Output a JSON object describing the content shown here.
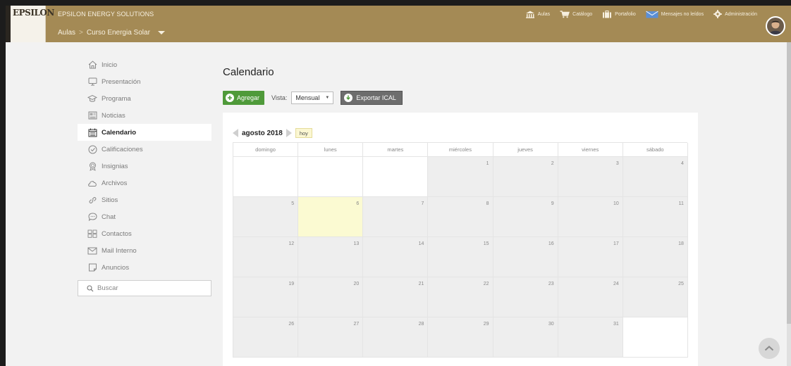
{
  "header": {
    "logo_text": "EPSILON",
    "org_name": "EPSILON ENERGY SOLUTIONS",
    "breadcrumb": {
      "root": "Aulas",
      "separator": ">",
      "current": "Curso Energia Solar"
    },
    "nav": [
      {
        "label": "Aulas",
        "icon": "building-icon"
      },
      {
        "label": "Catálogo",
        "icon": "cart-icon"
      },
      {
        "label": "Portafolio",
        "icon": "briefcase-icon"
      },
      {
        "label": "Mensajes no leídos",
        "icon": "envelope-icon"
      },
      {
        "label": "Administración",
        "icon": "gear-icon"
      }
    ]
  },
  "sidebar": {
    "items": [
      {
        "label": "Inicio",
        "icon": "home-icon",
        "active": false
      },
      {
        "label": "Presentación",
        "icon": "monitor-icon",
        "active": false
      },
      {
        "label": "Programa",
        "icon": "graduation-cap-icon",
        "active": false
      },
      {
        "label": "Noticias",
        "icon": "newspaper-icon",
        "active": false
      },
      {
        "label": "Calendario",
        "icon": "calendar-icon",
        "active": true
      },
      {
        "label": "Calificaciones",
        "icon": "check-circle-icon",
        "active": false
      },
      {
        "label": "Insignias",
        "icon": "badge-icon",
        "active": false
      },
      {
        "label": "Archivos",
        "icon": "cloud-icon",
        "active": false
      },
      {
        "label": "Sitios",
        "icon": "link-icon",
        "active": false
      },
      {
        "label": "Chat",
        "icon": "chat-icon",
        "active": false
      },
      {
        "label": "Contactos",
        "icon": "contacts-icon",
        "active": false
      },
      {
        "label": "Mail Interno",
        "icon": "mail-icon",
        "active": false
      },
      {
        "label": "Anuncios",
        "icon": "announcement-icon",
        "active": false
      }
    ],
    "search_label": "Buscar"
  },
  "main": {
    "title": "Calendario",
    "add_label": "Agregar",
    "vista_label": "Vista:",
    "vista_value": "Mensual",
    "export_label": "Exportar ICAL"
  },
  "calendar": {
    "month_label": "agosto 2018",
    "today_label": "hoy",
    "days_of_week": [
      "domingo",
      "lunes",
      "martes",
      "miércoles",
      "jueves",
      "viernes",
      "sábado"
    ],
    "weeks": [
      [
        "",
        "",
        "",
        "1",
        "2",
        "3",
        "4"
      ],
      [
        "5",
        "6",
        "7",
        "8",
        "9",
        "10",
        "11"
      ],
      [
        "12",
        "13",
        "14",
        "15",
        "16",
        "17",
        "18"
      ],
      [
        "19",
        "20",
        "21",
        "22",
        "23",
        "24",
        "25"
      ],
      [
        "26",
        "27",
        "28",
        "29",
        "30",
        "31",
        ""
      ]
    ],
    "today_day": "6"
  },
  "colors": {
    "header_bg": "#a48a55",
    "add_button": "#4f9a3a",
    "export_button": "#6d6d6d",
    "today_cell": "#fbfad2"
  }
}
